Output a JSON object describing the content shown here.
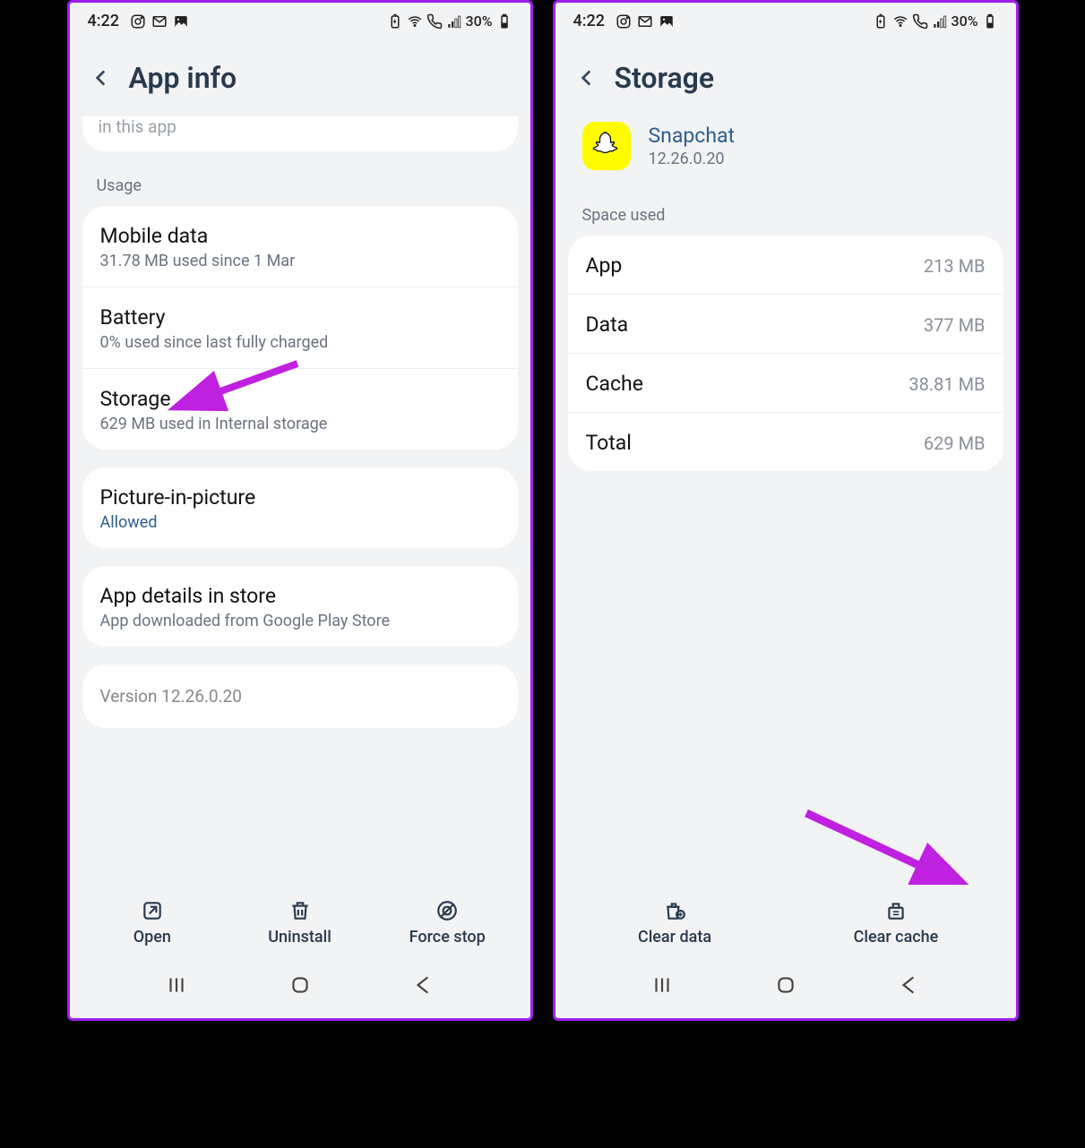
{
  "status": {
    "time": "4:22",
    "battery_pct": "30%"
  },
  "left": {
    "title": "App info",
    "cutoff_text": "in this app",
    "usage_label": "Usage",
    "rows": {
      "mobile_data": {
        "title": "Mobile data",
        "sub": "31.78 MB used since 1 Mar"
      },
      "battery": {
        "title": "Battery",
        "sub": "0% used since last fully charged"
      },
      "storage": {
        "title": "Storage",
        "sub": "629 MB used in Internal storage"
      }
    },
    "pip": {
      "title": "Picture-in-picture",
      "sub": "Allowed"
    },
    "store": {
      "title": "App details in store",
      "sub": "App downloaded from Google Play Store"
    },
    "version": "Version 12.26.0.20",
    "actions": {
      "open": "Open",
      "uninstall": "Uninstall",
      "force_stop": "Force stop"
    }
  },
  "right": {
    "title": "Storage",
    "app_name": "Snapchat",
    "app_version": "12.26.0.20",
    "space_label": "Space used",
    "rows": {
      "app": {
        "label": "App",
        "val": "213 MB"
      },
      "data": {
        "label": "Data",
        "val": "377 MB"
      },
      "cache": {
        "label": "Cache",
        "val": "38.81 MB"
      },
      "total": {
        "label": "Total",
        "val": "629 MB"
      }
    },
    "actions": {
      "clear_data": "Clear data",
      "clear_cache": "Clear cache"
    }
  }
}
